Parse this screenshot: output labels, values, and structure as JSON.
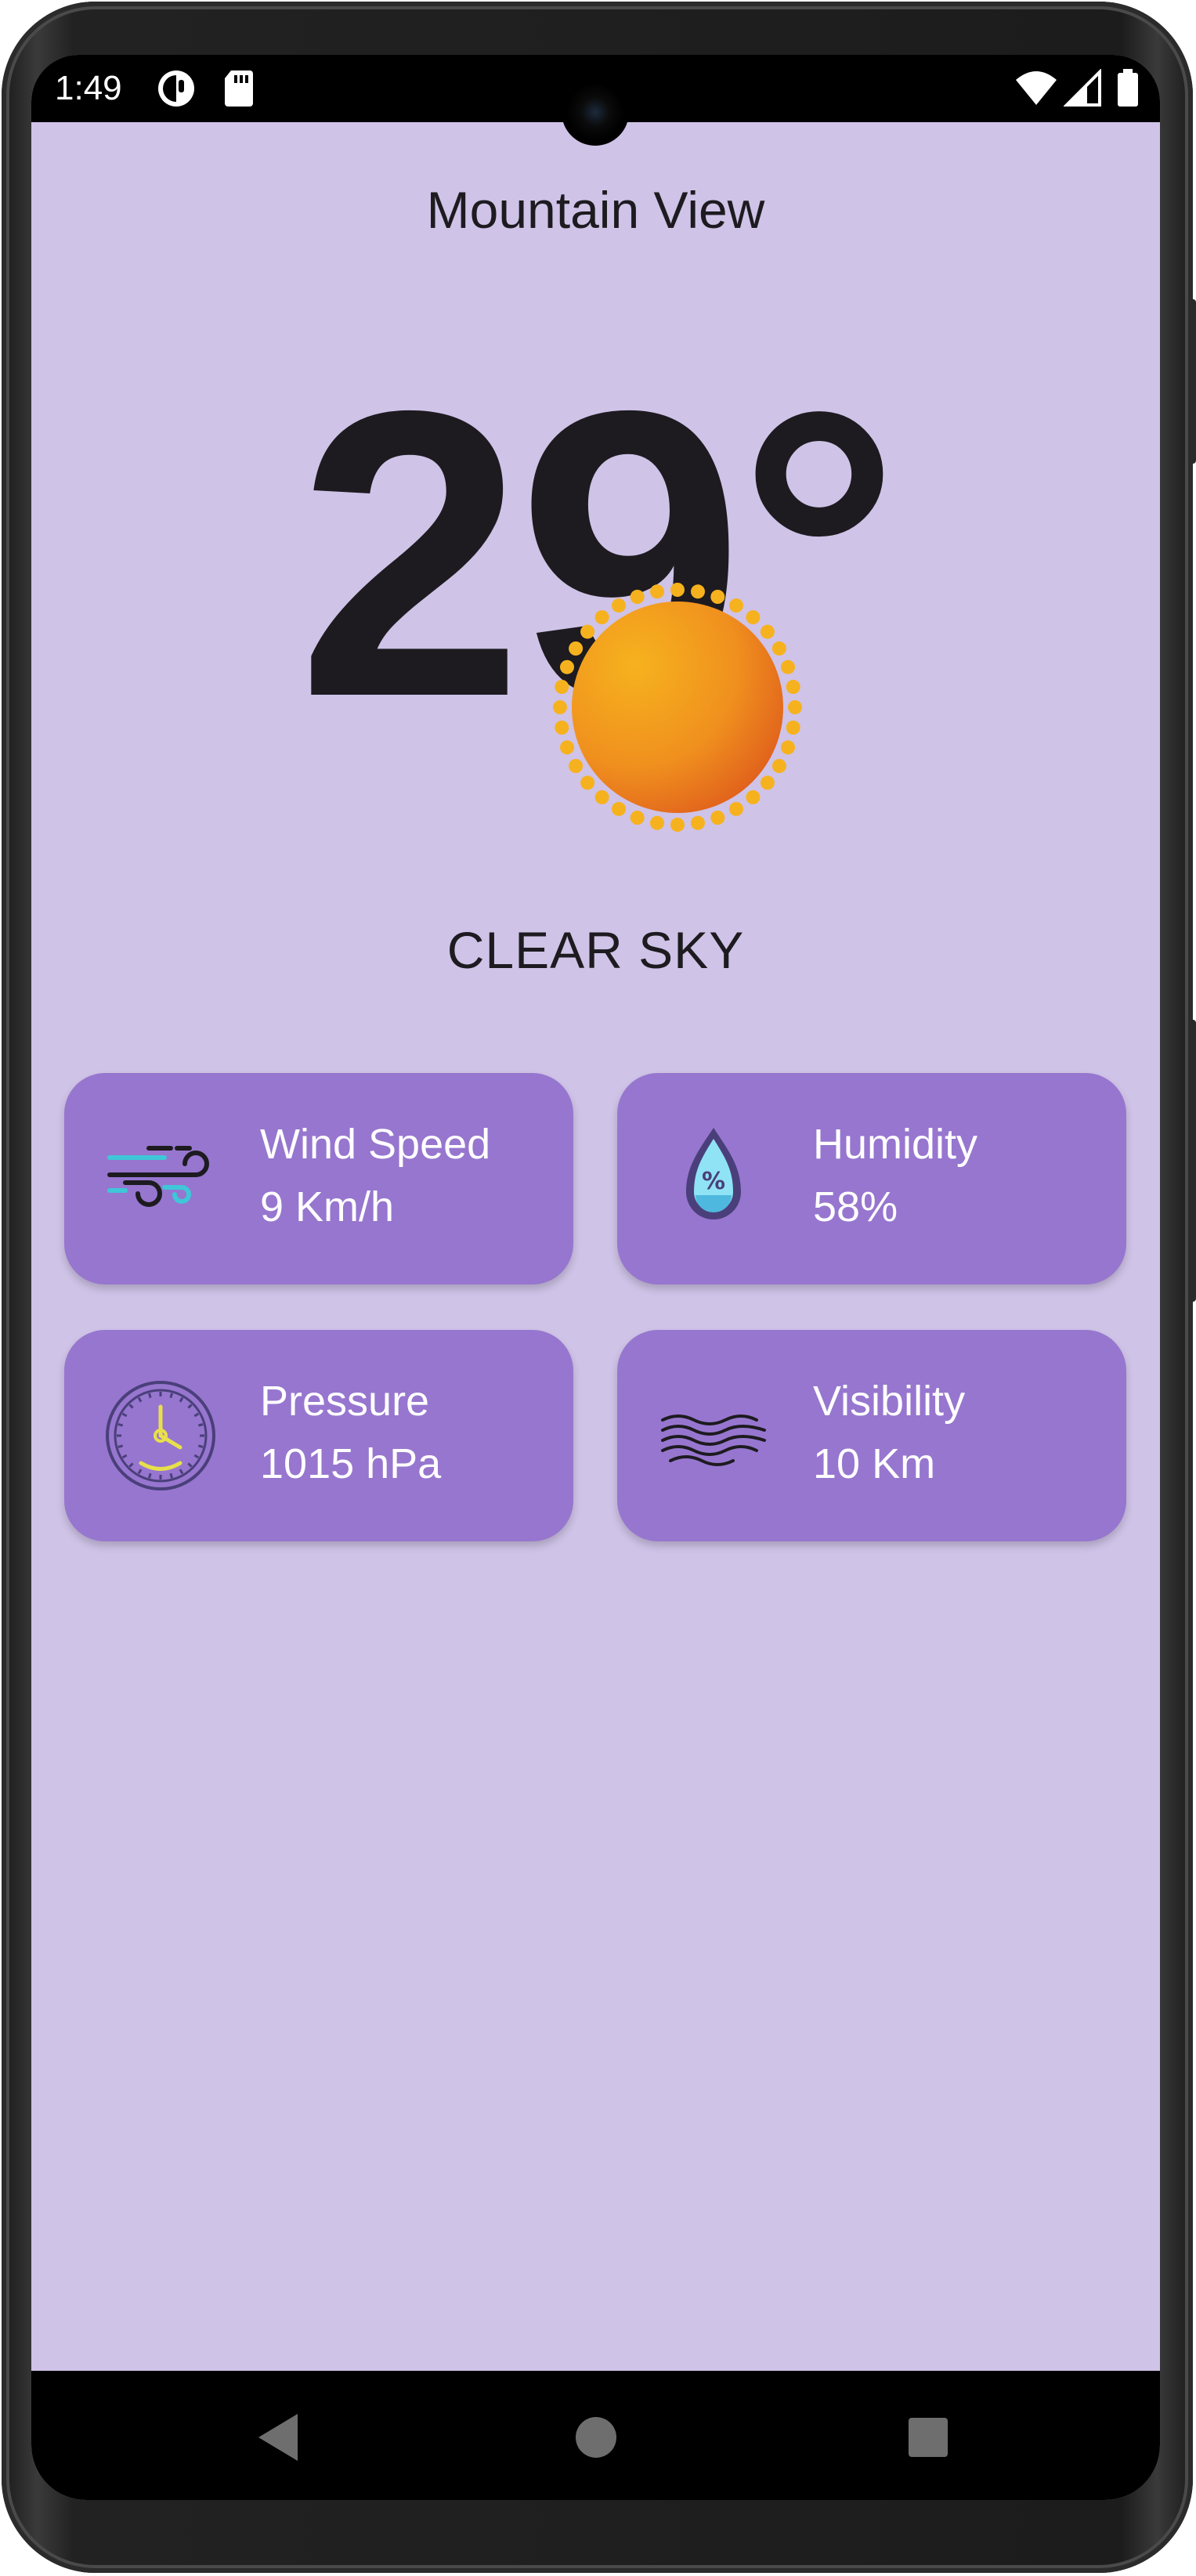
{
  "status_bar": {
    "time": "1:49"
  },
  "weather": {
    "city": "Mountain View",
    "temperature": "29°",
    "condition": "CLEAR SKY",
    "condition_icon": "sun-icon"
  },
  "cards": [
    {
      "title": "Wind Speed",
      "value": "9 Km/h",
      "icon": "wind-icon"
    },
    {
      "title": "Humidity",
      "value": "58%",
      "icon": "humidity-icon"
    },
    {
      "title": "Pressure",
      "value": "1015 hPa",
      "icon": "pressure-gauge-icon"
    },
    {
      "title": "Visibility",
      "value": "10 Km",
      "icon": "visibility-haze-icon"
    }
  ],
  "colors": {
    "background": "#cfc3e7",
    "card": "#9776cf",
    "text_dark": "#1d1b20",
    "text_light": "#ffffff"
  }
}
